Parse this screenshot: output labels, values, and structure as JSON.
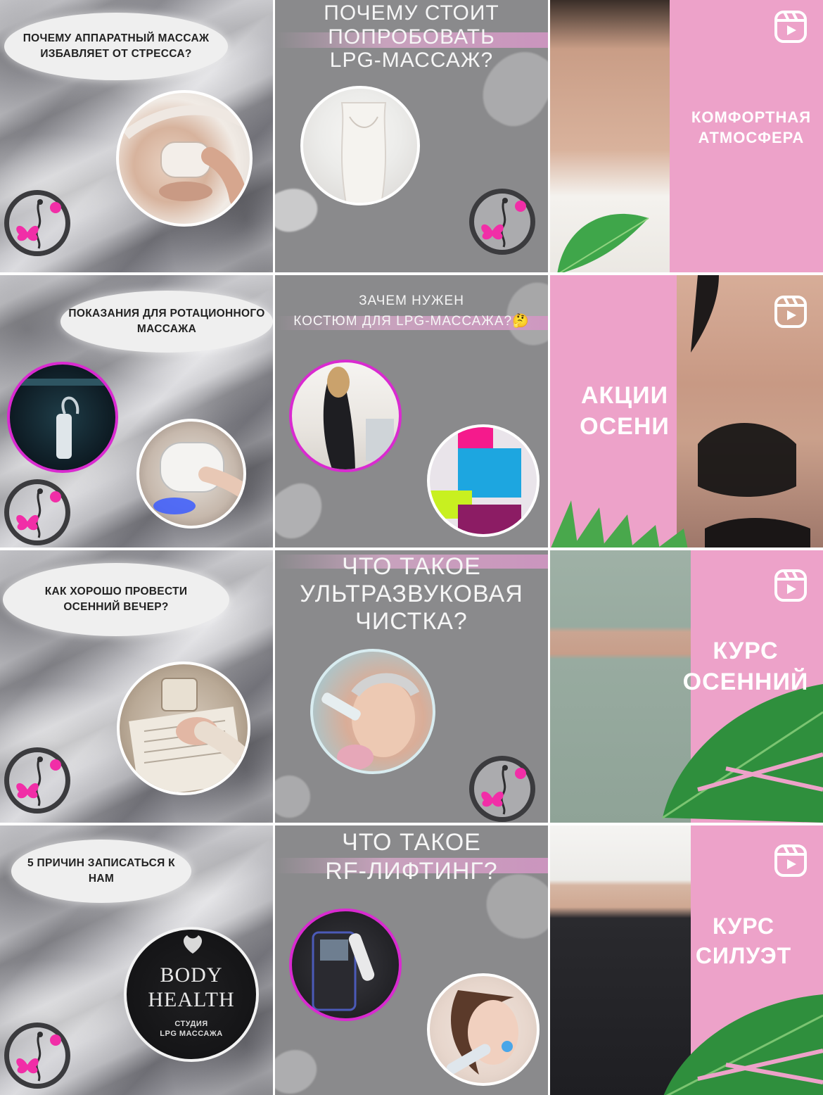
{
  "feed": {
    "row1": {
      "post1_text": "ПОЧЕМУ АППАРАТНЫЙ МАССАЖ ИЗБАВЛЯЕТ ОТ СТРЕССА?",
      "post2_line1": "ПОЧЕМУ СТОИТ",
      "post2_line2": "ПОПРОБОВАТЬ",
      "post2_line3": "LPG-МАССАЖ?",
      "post3_text_line1": "КОМФОРТНАЯ",
      "post3_text_line2": "АТМОСФЕРА"
    },
    "row2": {
      "post1_text": "ПОКАЗАНИЯ ДЛЯ РОТАЦИОННОГО МАССАЖА",
      "post2_line1": "ЗАЧЕМ НУЖЕН",
      "post2_line2": "КОСТЮМ ДЛЯ LPG-МАССАЖА?",
      "post2_emoji": "🤔",
      "post3_text_line1": "АКЦИИ",
      "post3_text_line2": "ОСЕНИ"
    },
    "row3": {
      "post1_text": "КАК ХОРОШО ПРОВЕСТИ ОСЕННИЙ ВЕЧЕР?",
      "post2_line1": "ЧТО ТАКОЕ",
      "post2_line2": "УЛЬТРАЗВУКОВАЯ",
      "post2_line3": "ЧИСТКА?",
      "post3_text_line1": "КУРС",
      "post3_text_line2": "ОСЕННИЙ"
    },
    "row4": {
      "post1_text": "5 ПРИЧИН ЗАПИСАТЬСЯ К НАМ",
      "post1_logo_line1": "BODY",
      "post1_logo_line2": "HEALTH",
      "post1_logo_line3": "СТУДИЯ",
      "post1_logo_line4": "LPG МАССАЖА",
      "post2_line1": "ЧТО ТАКОЕ",
      "post2_line2": "RF-ЛИФТИНГ?",
      "post3_text_line1": "КУРС",
      "post3_text_line2": "СИЛУЭТ"
    }
  },
  "icons": {
    "reel": "reels-icon",
    "logo": "studio-logo-icon"
  },
  "colors": {
    "pink_bg": "#eda2c9",
    "grey_bg": "#8a8a8c",
    "accent_magenta": "#d92ad0",
    "logo_dot": "#f12ea7"
  }
}
